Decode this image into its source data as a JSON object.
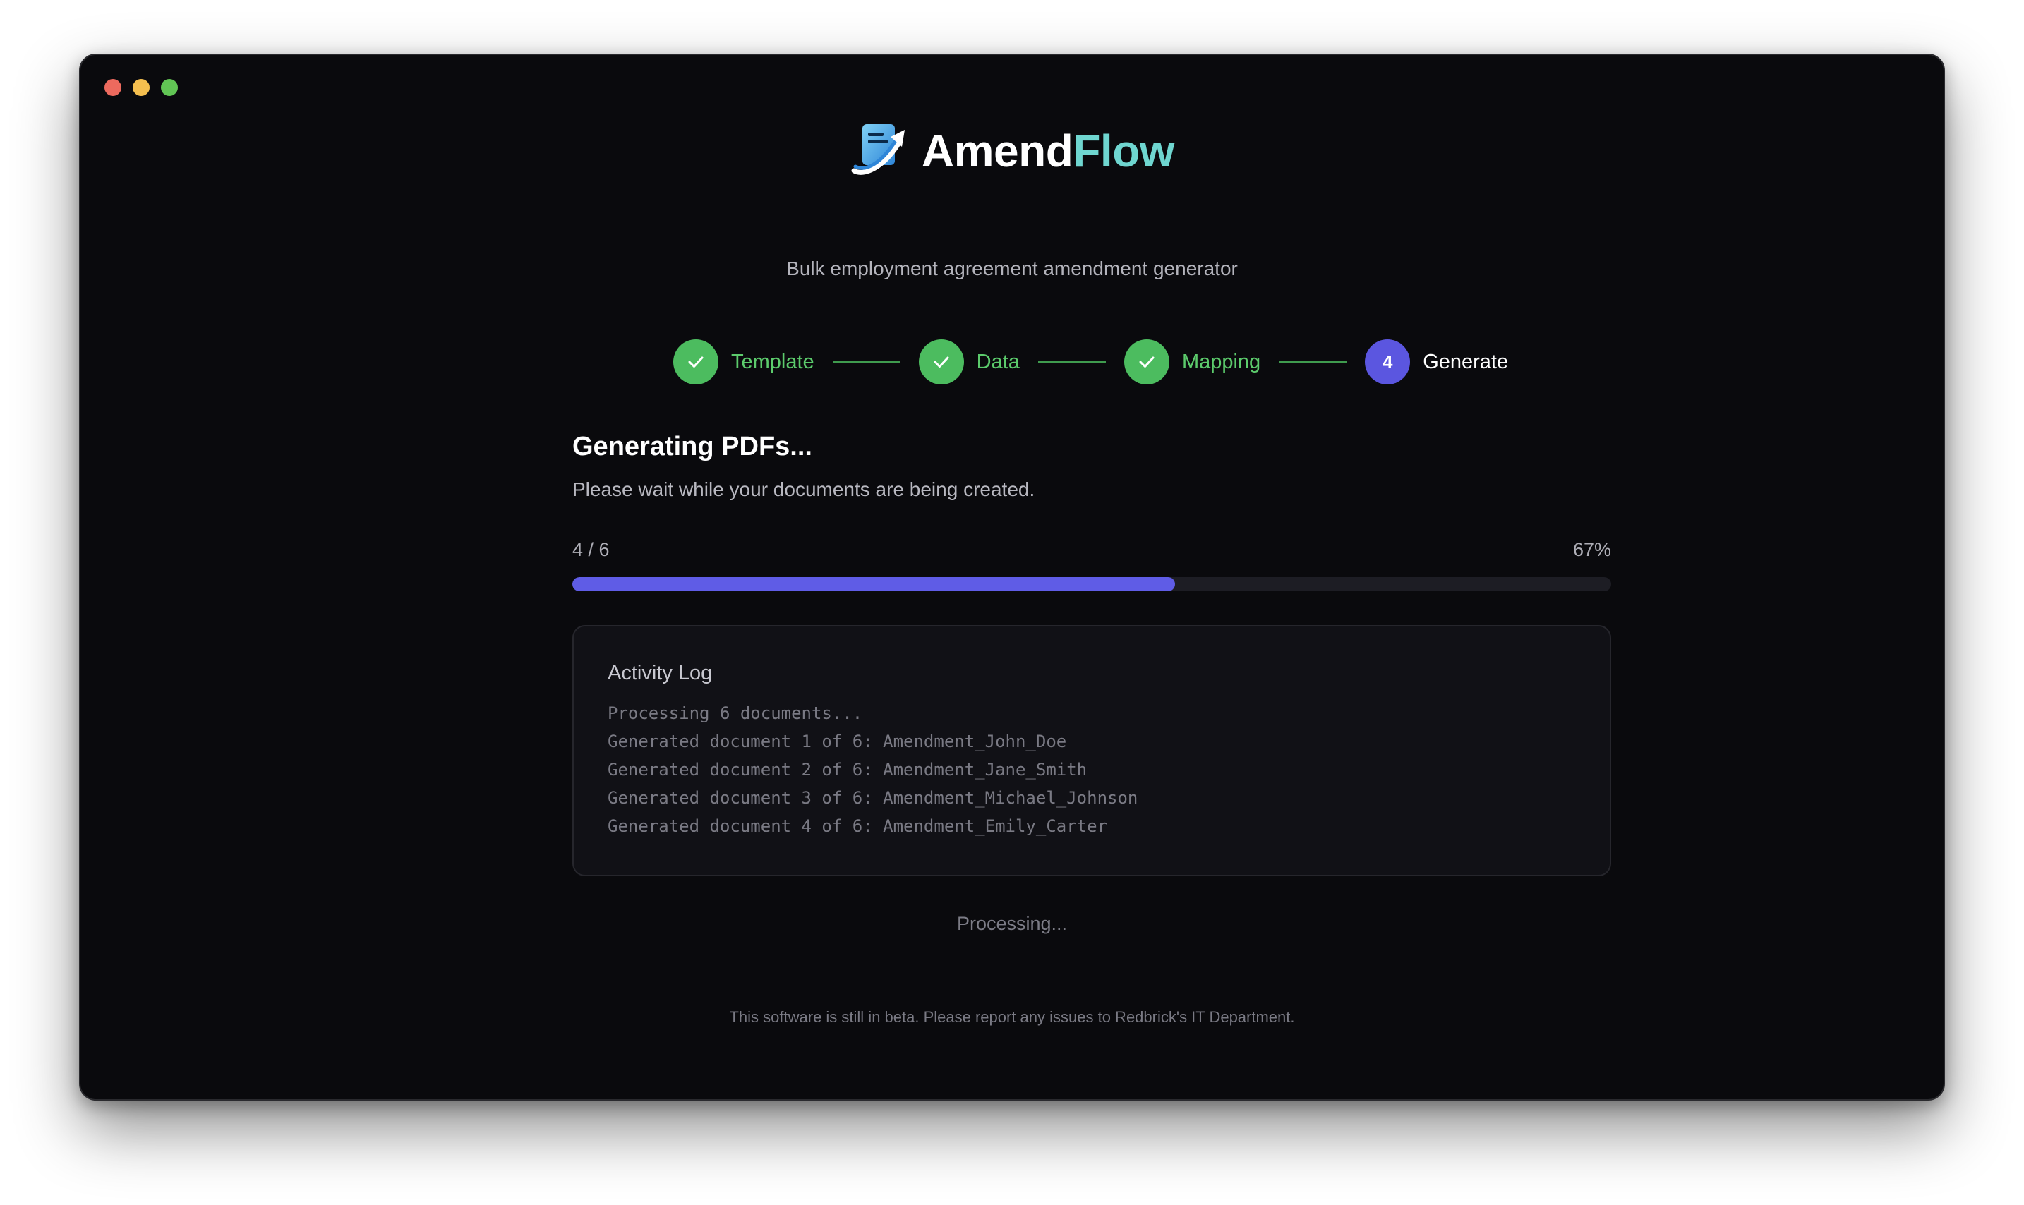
{
  "app": {
    "name_part1": "Amend",
    "name_part2": "Flow",
    "subtitle": "Bulk employment agreement amendment generator",
    "brand_colors": {
      "primary_text": "#ffffff",
      "accent": "#6fd6d0"
    }
  },
  "steps": [
    {
      "label": "Template",
      "state": "done"
    },
    {
      "label": "Data",
      "state": "done"
    },
    {
      "label": "Mapping",
      "state": "done"
    },
    {
      "label": "Generate",
      "state": "active",
      "number": "4"
    }
  ],
  "generation": {
    "title": "Generating PDFs...",
    "description": "Please wait while your documents are being created.",
    "count_text": "4 / 6",
    "percent_text": "67%",
    "progress_fraction": 0.58,
    "progress_color": "#5f5ce6"
  },
  "activity_log": {
    "title": "Activity Log",
    "lines": [
      "Processing 6 documents...",
      "Generated document 1 of 6: Amendment_John_Doe",
      "Generated document 2 of 6: Amendment_Jane_Smith",
      "Generated document 3 of 6: Amendment_Michael_Johnson",
      "Generated document 4 of 6: Amendment_Emily_Carter"
    ]
  },
  "status_text": "Processing...",
  "footer_text": "This software is still in beta. Please report any issues to Redbrick's IT Department.",
  "colors": {
    "done": "#4cbc5f",
    "active": "#5b56e0",
    "background": "#0a0a0d"
  },
  "icons": {
    "logo": "document-arrow-icon",
    "done_step": "check-icon"
  }
}
